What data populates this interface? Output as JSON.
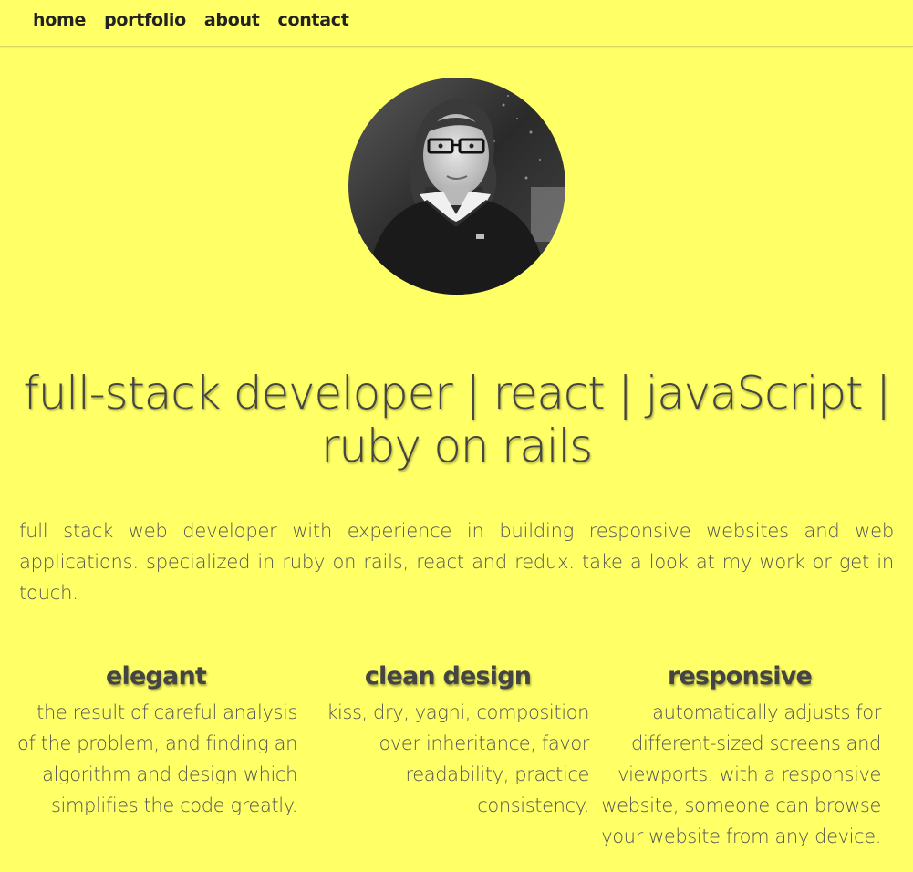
{
  "nav": {
    "items": [
      {
        "label": "home"
      },
      {
        "label": "portfolio"
      },
      {
        "label": "about"
      },
      {
        "label": "contact"
      }
    ]
  },
  "hero": {
    "avatar_icon": "profile-photo",
    "headline": "full-stack developer | react | javaScript | ruby on rails",
    "intro": "full stack web developer with experience in building responsive websites and web applications. specialized in ruby on rails, react and redux. take a look at my work or get in touch."
  },
  "features": [
    {
      "title": "elegant",
      "text": "the result of careful analysis of the problem, and finding an algorithm and design which simplifies the code greatly."
    },
    {
      "title": "clean design",
      "text": "kiss, dry, yagni, composition over inheritance, favor readability, practice consistency."
    },
    {
      "title": "responsive",
      "text": "automatically adjusts for different-sized screens and viewports. with a responsive website, someone can browse your website from any device."
    }
  ],
  "colors": {
    "background": "#ffff66",
    "text": "#444444"
  }
}
